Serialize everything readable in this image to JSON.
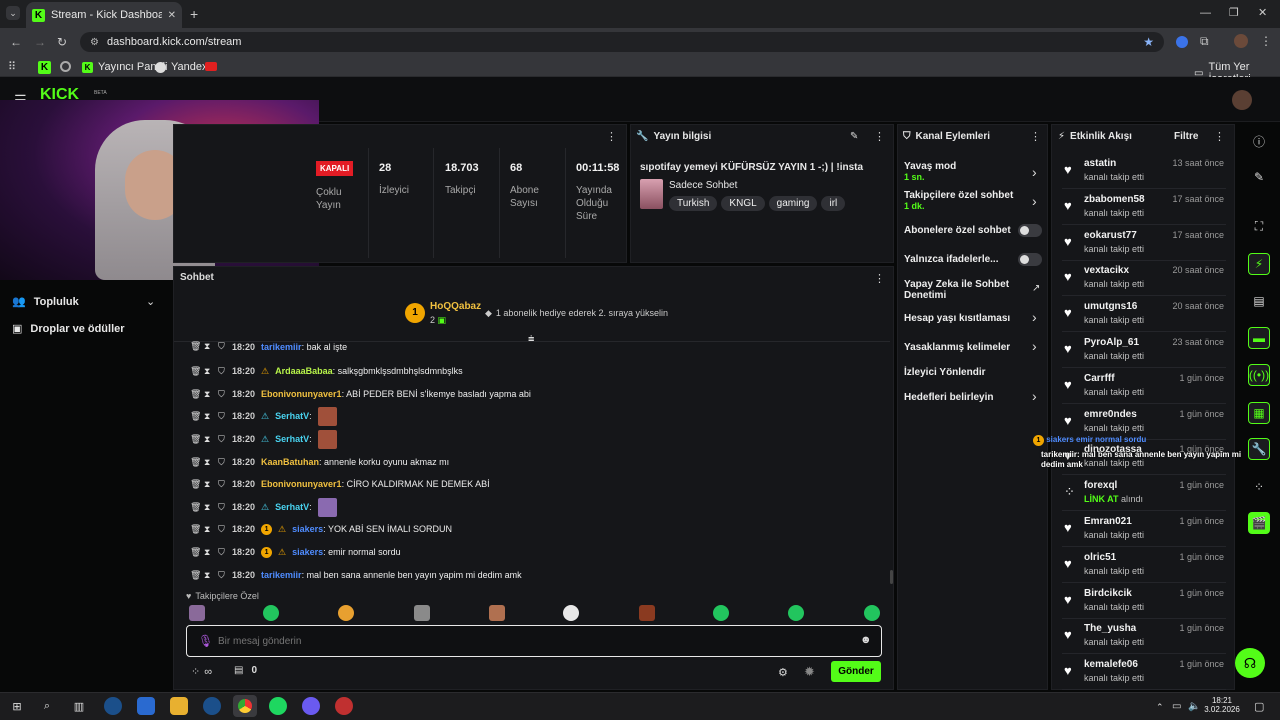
{
  "browser": {
    "tab_title": "Stream - Kick Dashboard",
    "url": "dashboard.kick.com/stream",
    "bookmarks": [
      "Yayıncı Paneli",
      "Yandex"
    ],
    "bookmarks_right": "Tüm Yer İşaretleri"
  },
  "header": {
    "logo": "KICK",
    "beta": "BETA"
  },
  "stream_stats": {
    "status": "KAPALI",
    "status_label": "Çoklu Yayın",
    "viewers": "28",
    "viewers_label": "İzleyici",
    "followers": "18.703",
    "followers_label": "Takipçi",
    "subs": "68",
    "subs_label": "Abone Sayısı",
    "uptime": "00:11:58",
    "uptime_label": "Yayında Olduğu Süre"
  },
  "stream_info": {
    "header": "Yayın bilgisi",
    "title": "sıpotifay yemeyi KÜFÜRSÜZ YAYIN 1 -;) | !insta",
    "category": "Sadece Sohbet",
    "tags": [
      "Turkish",
      "KNGL",
      "gaming",
      "irl"
    ]
  },
  "channel_actions": {
    "header": "Kanal Eylemleri",
    "slow_mode": "Yavaş mod",
    "slow_mode_value": "1 sn.",
    "followers_only": "Takipçilere özel sohbet",
    "followers_only_value": "1 dk.",
    "subs_only": "Abonelere özel sohbet",
    "emotes_only": "Yalnızca ifadelerle...",
    "ai_mod": "Yapay Zeka ile Sohbet Denetimi",
    "account_age": "Hesap yaşı kısıtlaması",
    "banned_words": "Yasaklanmış kelimeler",
    "redirect": "İzleyici Yönlendir",
    "goals": "Hedefleri belirleyin"
  },
  "activity": {
    "header": "Etkinlik Akışı",
    "filter": "Filtre",
    "events": [
      {
        "name": "astatin",
        "action": "kanalı takip etti",
        "time": "13 saat önce"
      },
      {
        "name": "zbabomen58",
        "action": "kanalı takip etti",
        "time": "17 saat önce"
      },
      {
        "name": "eokarust77",
        "action": "kanalı takip etti",
        "time": "17 saat önce"
      },
      {
        "name": "vextacikx",
        "action": "kanalı takip etti",
        "time": "20 saat önce"
      },
      {
        "name": "umutgns16",
        "action": "kanalı takip etti",
        "time": "20 saat önce"
      },
      {
        "name": "PyroAlp_61",
        "action": "kanalı takip etti",
        "time": "23 saat önce"
      },
      {
        "name": "Carrfff",
        "action": "kanalı takip etti",
        "time": "1 gün önce"
      },
      {
        "name": "emre0ndes",
        "action": "kanalı takip etti",
        "time": "1 gün önce"
      },
      {
        "name": "dinozotassa",
        "action": "kanalı takip etti",
        "time": "1 gün önce"
      },
      {
        "name": "forexql",
        "action": "LİNK AT alındı",
        "time": "1 gün önce"
      },
      {
        "name": "Emran021",
        "action": "kanalı takip etti",
        "time": "1 gün önce"
      },
      {
        "name": "olric51",
        "action": "kanalı takip etti",
        "time": "1 gün önce"
      },
      {
        "name": "Birdcikcik",
        "action": "kanalı takip etti",
        "time": "1 gün önce"
      },
      {
        "name": "The_yusha",
        "action": "kanalı takip etti",
        "time": "1 gün önce"
      },
      {
        "name": "kemalefe06",
        "action": "kanalı takip etti",
        "time": "1 gün önce"
      }
    ],
    "overlay_1": "siakers emir normal sordu",
    "overlay_2": "tarikemiir: mal ben sana annenle ben yayın yapim mi dedim amk"
  },
  "sidebar": {
    "community": "Topluluk",
    "drops": "Droplar ve ödüller"
  },
  "chat": {
    "header": "Sohbet",
    "top_user": "HoQQabaz",
    "top_user_count": "2",
    "gift_hint": "1 abonelik hediye ederek 2. sıraya yükselin",
    "messages": [
      {
        "time": "18:20",
        "user": "tarikemiir",
        "text": ": bak al işte",
        "color": "#4f8cff"
      },
      {
        "time": "18:20",
        "user": "ArdaaaBabaa",
        "text": ": salkşgbmklşsdmbhşlsdmnbşlks",
        "color": "#b7f34a"
      },
      {
        "time": "18:20",
        "user": "Ebonivonunyaver1",
        "text": ": ABİ PEDER BENİ s'İkemye basladı yapma abi",
        "color": "#f0c040"
      },
      {
        "time": "18:20",
        "user": "SerhatV",
        "text": ":",
        "color": "#49d3f0"
      },
      {
        "time": "18:20",
        "user": "SerhatV",
        "text": ":",
        "color": "#49d3f0"
      },
      {
        "time": "18:20",
        "user": "KaanBatuhan",
        "text": ": annenle korku oyunu akmaz mı",
        "color": "#f0c040"
      },
      {
        "time": "18:20",
        "user": "Ebonivonunyaver1",
        "text": ": CİRO KALDIRMAK NE DEMEK ABİ",
        "color": "#f0c040"
      },
      {
        "time": "18:20",
        "user": "SerhatV",
        "text": ":",
        "color": "#49d3f0"
      },
      {
        "time": "18:20",
        "user": "siakers",
        "text": ": YOK ABİ SEN İMALI SORDUN",
        "color": "#4f8cff"
      },
      {
        "time": "18:20",
        "user": "siakers",
        "text": ": emir normal sordu",
        "color": "#4f8cff"
      },
      {
        "time": "18:20",
        "user": "tarikemiir",
        "text": ": mal ben sana annenle ben yayın yapim mi dedim amk",
        "color": "#4f8cff"
      }
    ],
    "followers_only_label": "Takipçilere Özel",
    "placeholder": "Bir mesaj gönderin",
    "points": "∞",
    "gifts": "0",
    "send": "Gönder"
  },
  "taskbar": {
    "time": "18:21",
    "date": "3.02.2026"
  },
  "colors": {
    "accent": "#53fc18"
  }
}
